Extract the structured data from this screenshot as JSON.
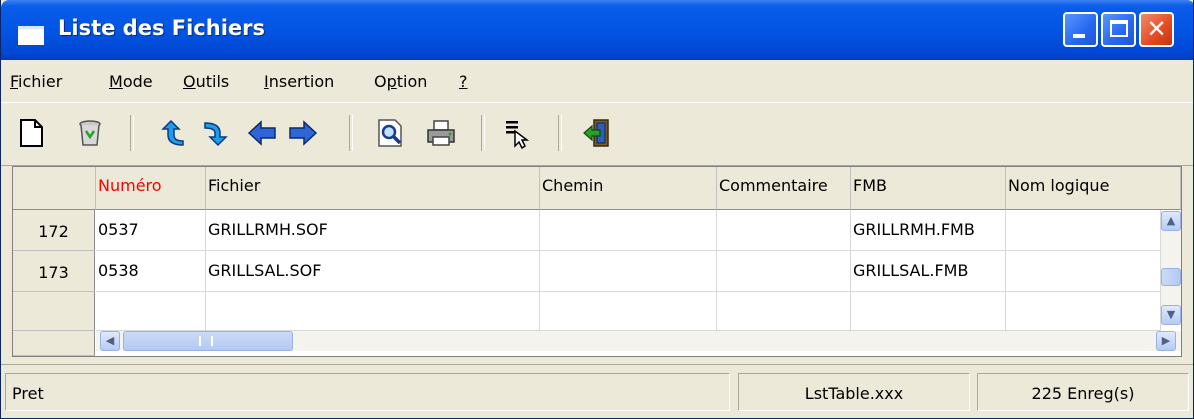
{
  "window": {
    "title": "Liste des Fichiers",
    "close_glyph": "✕"
  },
  "menu": [
    {
      "label": "Fichier",
      "accel": "F",
      "rest": "ichier"
    },
    {
      "label": "Mode",
      "accel": "M",
      "rest": "ode"
    },
    {
      "label": "Outils",
      "accel": "O",
      "rest": "utils"
    },
    {
      "label": "Insertion",
      "accel": "I",
      "rest": "nsertion"
    },
    {
      "label": "Option",
      "accel": "p",
      "pre": "O",
      "rest": "tion"
    },
    {
      "label": "?",
      "accel": "?",
      "rest": ""
    }
  ],
  "toolbar": {
    "icons": [
      "new-document-icon",
      "recycle-bin-icon",
      "arrow-up-curved-icon",
      "arrow-down-curved-icon",
      "arrow-left-icon",
      "arrow-right-icon",
      "search-magnifier-icon",
      "printer-icon",
      "select-cursor-icon",
      "exit-door-icon"
    ]
  },
  "table": {
    "columns": [
      "Numéro",
      "Fichier",
      "Chemin",
      "Commentaire",
      "FMB",
      "Nom logique"
    ],
    "highlight_column_color": "#ff0000",
    "rows": [
      {
        "row_num": "172",
        "cells": [
          "0537",
          "GRILLRMH.SOF",
          "",
          "",
          "GRILLRMH.FMB",
          ""
        ]
      },
      {
        "row_num": "173",
        "cells": [
          "0538",
          "GRILLSAL.SOF",
          "",
          "",
          "GRILLSAL.FMB",
          ""
        ]
      }
    ]
  },
  "scrollbars": {
    "up": "▲",
    "down": "▼",
    "left": "◀",
    "right": "▶"
  },
  "status": {
    "state": "Pret",
    "table": "LstTable.xxx",
    "count": "225 Enreg(s)"
  }
}
